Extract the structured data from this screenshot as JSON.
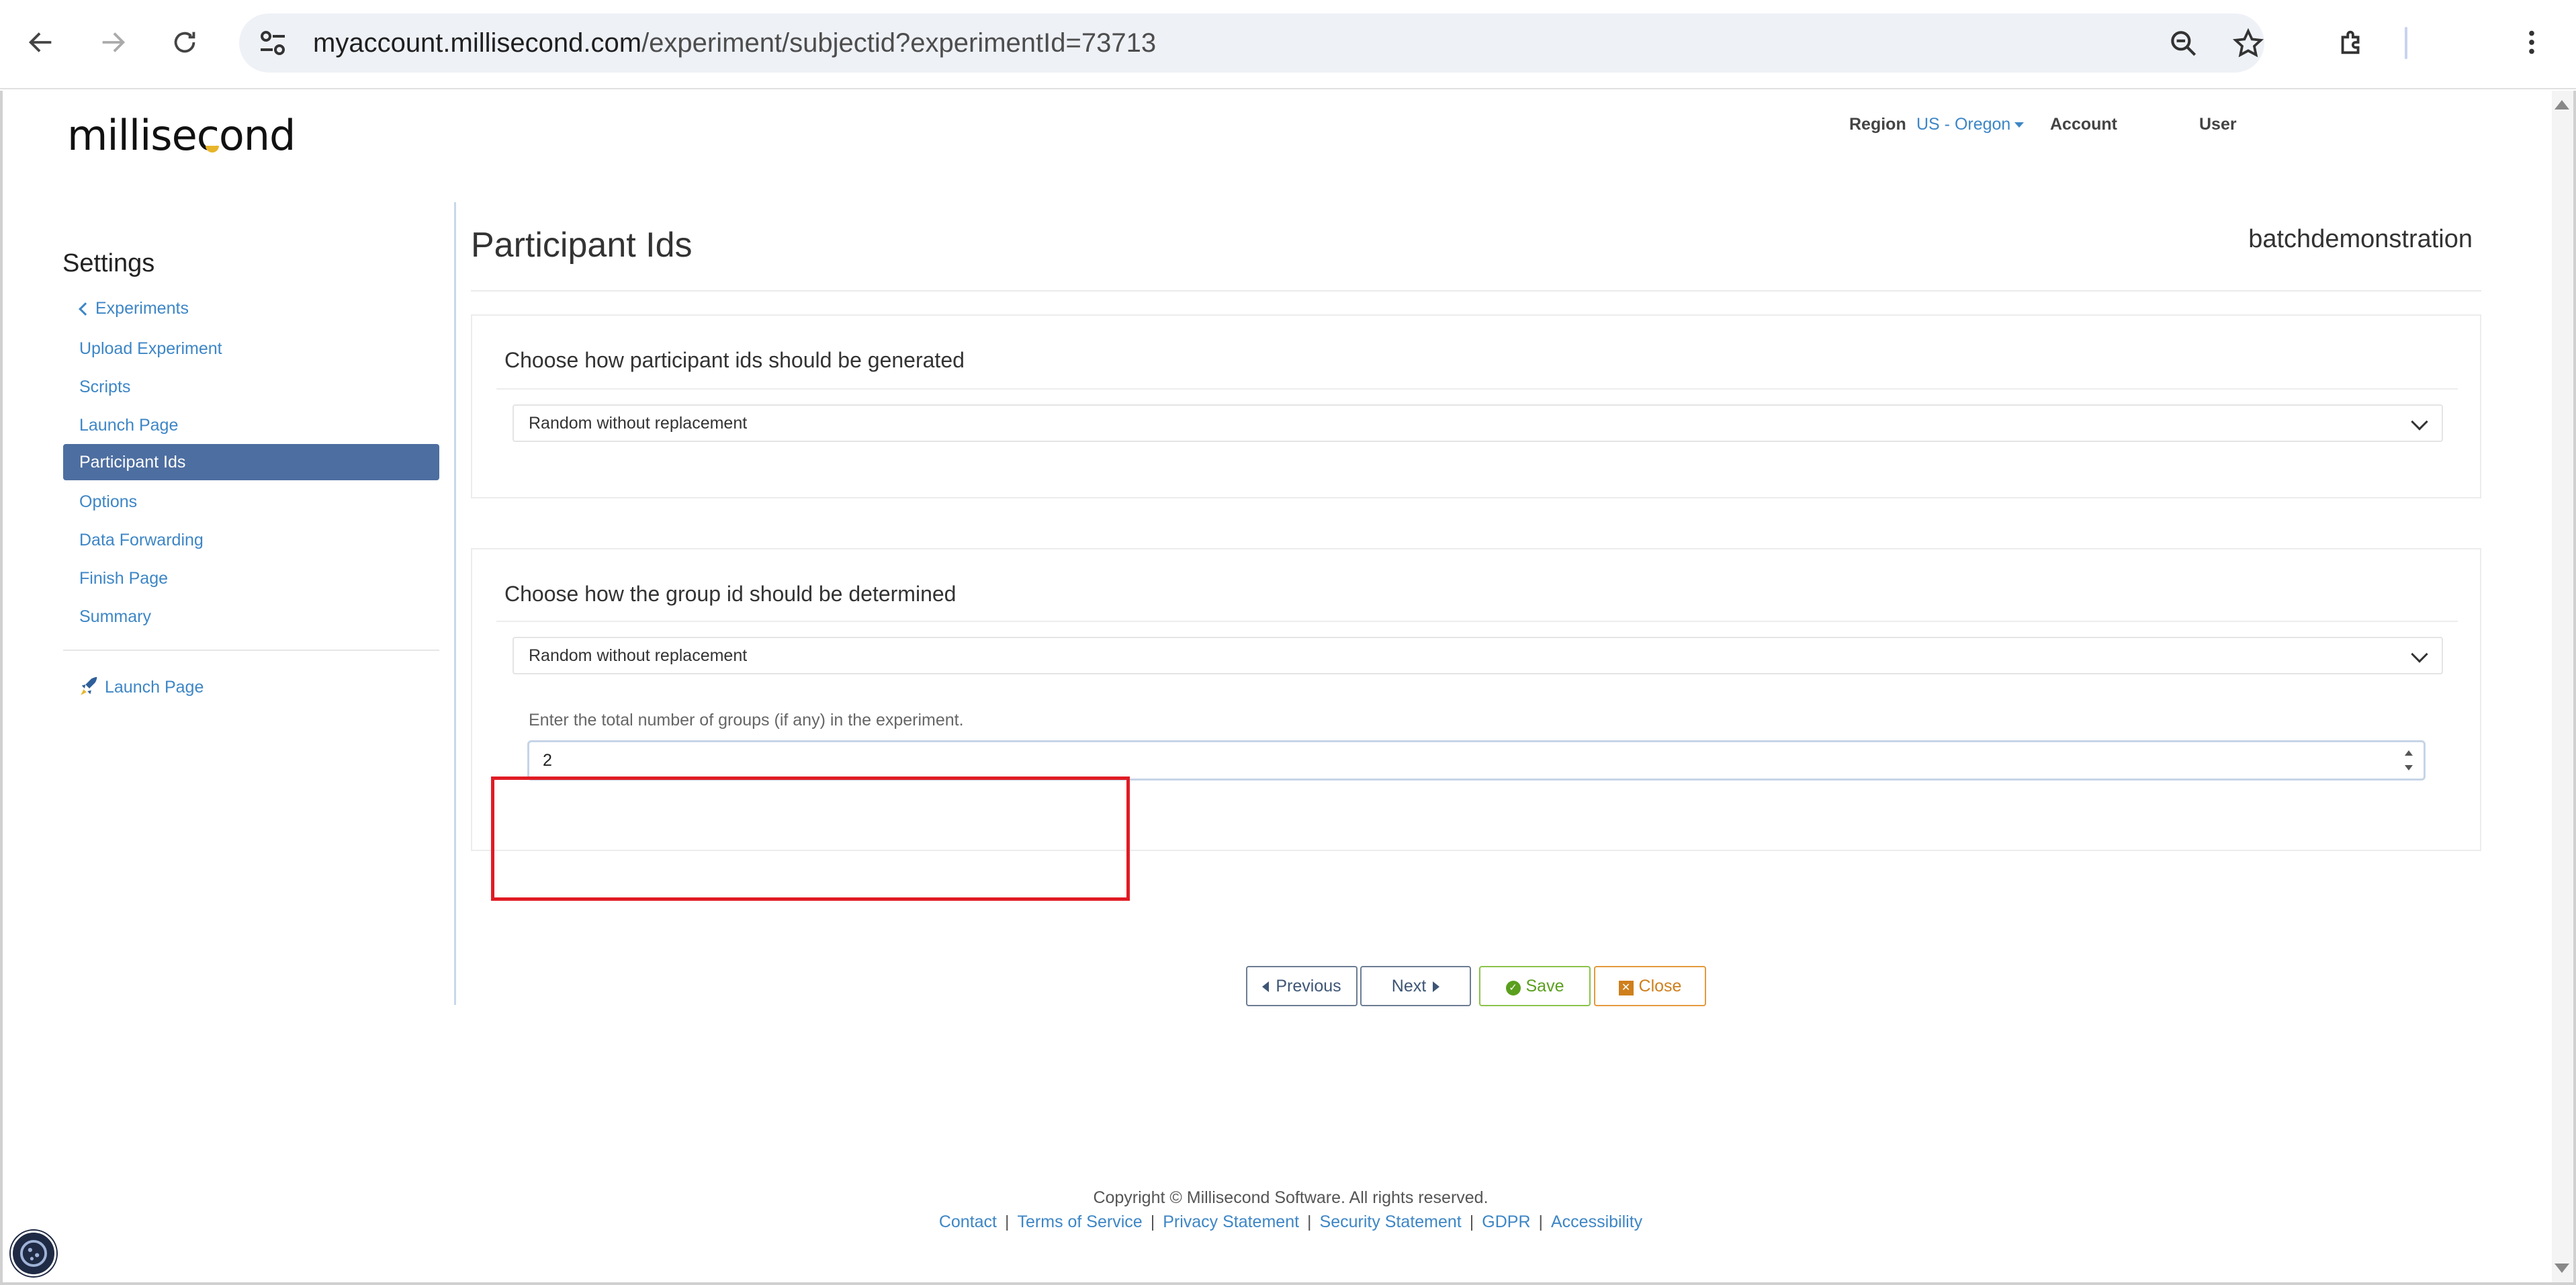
{
  "browser": {
    "url_host": "myaccount.millisecond.com",
    "url_path": "/experiment/subjectid?experimentId=73713"
  },
  "header": {
    "logo_text": "millisecond",
    "region_label": "Region",
    "region_value": "US - Oregon",
    "account_label": "Account",
    "user_label": "User"
  },
  "sidebar": {
    "title": "Settings",
    "back_label": "Experiments",
    "items": [
      {
        "label": "Upload Experiment"
      },
      {
        "label": "Scripts"
      },
      {
        "label": "Launch Page"
      },
      {
        "label": "Participant Ids"
      },
      {
        "label": "Options"
      },
      {
        "label": "Data Forwarding"
      },
      {
        "label": "Finish Page"
      },
      {
        "label": "Summary"
      }
    ],
    "active_item": "Participant Ids",
    "launch_link": "Launch Page"
  },
  "main": {
    "title": "Participant Ids",
    "account_name": "batchdemonstration",
    "participant_card": {
      "title": "Choose how participant ids should be generated",
      "selected": "Random without replacement"
    },
    "group_card": {
      "title": "Choose how the group id should be determined",
      "selected": "Random without replacement",
      "groups_label": "Enter the total number of groups (if any) in the experiment.",
      "groups_value": "2"
    },
    "buttons": {
      "previous": "Previous",
      "next": "Next",
      "save": "Save",
      "close": "Close"
    }
  },
  "footer": {
    "copyright": "Copyright © Millisecond Software. All rights reserved.",
    "links": [
      "Contact",
      "Terms of Service",
      "Privacy Statement",
      "Security Statement",
      "GDPR",
      "Accessibility"
    ]
  }
}
